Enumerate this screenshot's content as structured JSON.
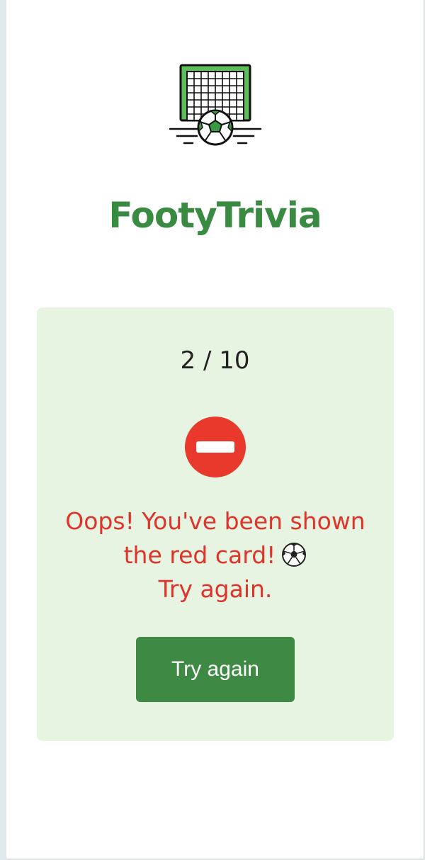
{
  "app": {
    "title": "FootyTrivia",
    "logo_icon": "soccer-goal-icon"
  },
  "quiz": {
    "progress": "2 / 10",
    "current_question": 2,
    "total_questions": 10
  },
  "result": {
    "status_icon": "stop-icon",
    "message": "Oops! You've been shown the red card!",
    "message_suffix_icon": "soccer-ball-icon",
    "message_tail": "Try again.",
    "retry_label": "Try again"
  },
  "colors": {
    "brand_green": "#3a8b42",
    "error_red": "#e0342a",
    "card_background": "#e7f4e2",
    "button_green": "#3e8a44"
  }
}
